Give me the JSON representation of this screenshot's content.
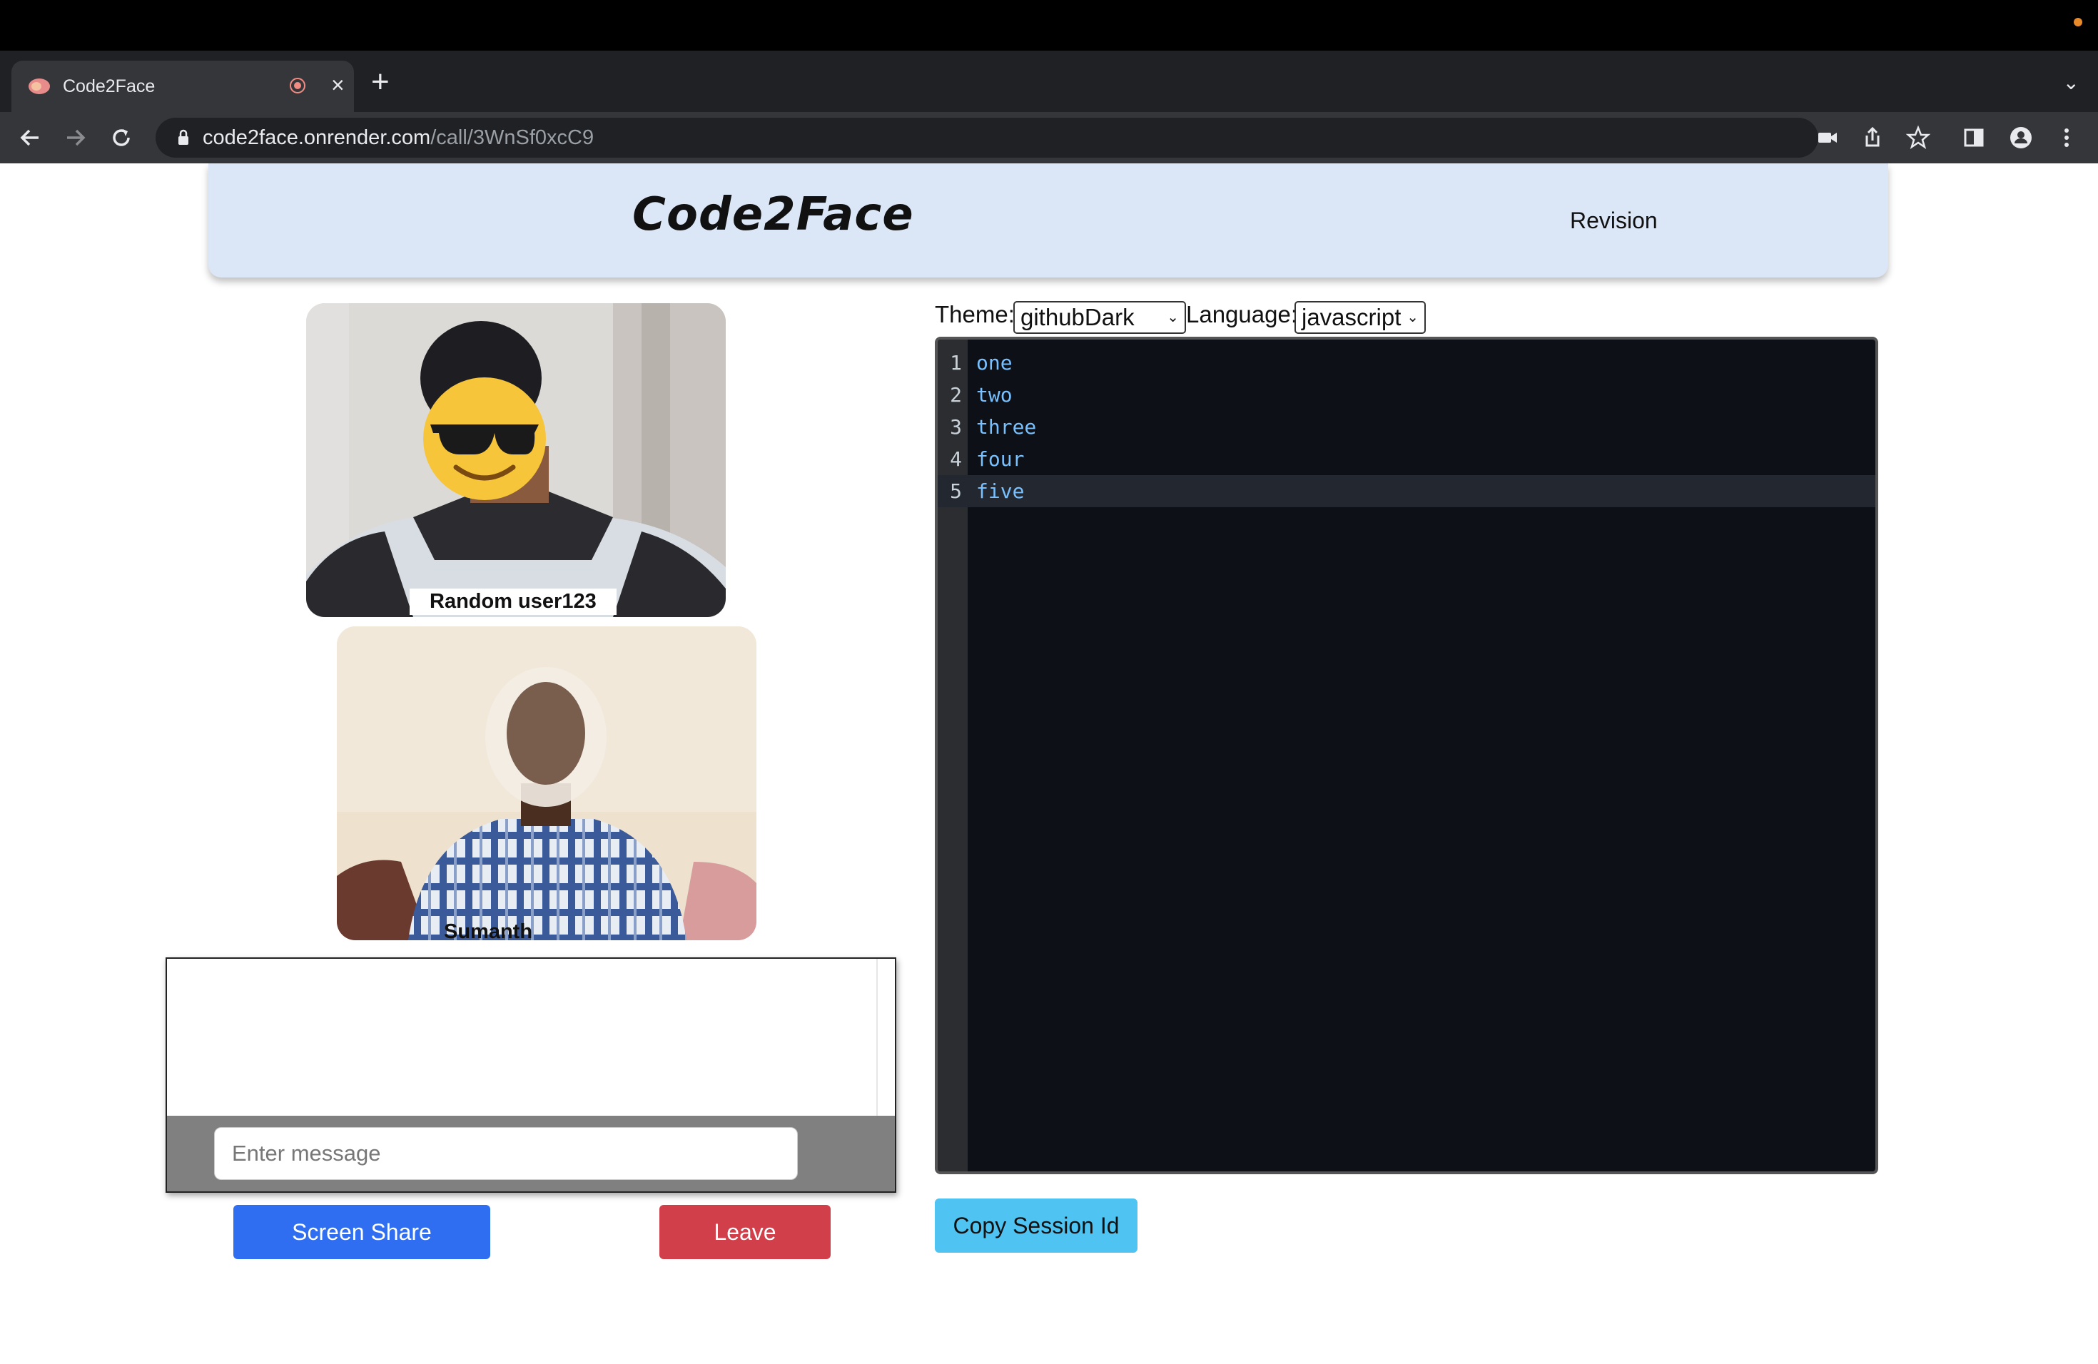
{
  "browser": {
    "tab_title": "Code2Face",
    "new_tab": "+",
    "close_tab": "×",
    "url_host": "code2face.onrender.com",
    "url_path": "/call/3WnSf0xcC9"
  },
  "header": {
    "brand": "Code2Face",
    "revision": "Revision"
  },
  "videos": [
    {
      "name": "Random user123"
    },
    {
      "name": "Sumanth"
    }
  ],
  "chat": {
    "placeholder": "Enter message"
  },
  "buttons": {
    "screen_share": "Screen Share",
    "leave": "Leave",
    "copy_session": "Copy Session Id"
  },
  "editor": {
    "theme_label": "Theme:",
    "theme_value": "githubDark",
    "language_label": "Language:",
    "language_value": "javascript",
    "lines": [
      {
        "num": "1",
        "code": "one"
      },
      {
        "num": "2",
        "code": "two"
      },
      {
        "num": "3",
        "code": "three"
      },
      {
        "num": "4",
        "code": "four"
      },
      {
        "num": "5",
        "code": "five"
      }
    ],
    "active_line": 5
  },
  "icons": [
    "lock-icon",
    "camera-icon",
    "share-icon",
    "star-icon",
    "sidepanel-icon",
    "profile-icon",
    "menu-icon",
    "back-icon",
    "forward-icon",
    "reload-icon",
    "record-icon"
  ]
}
